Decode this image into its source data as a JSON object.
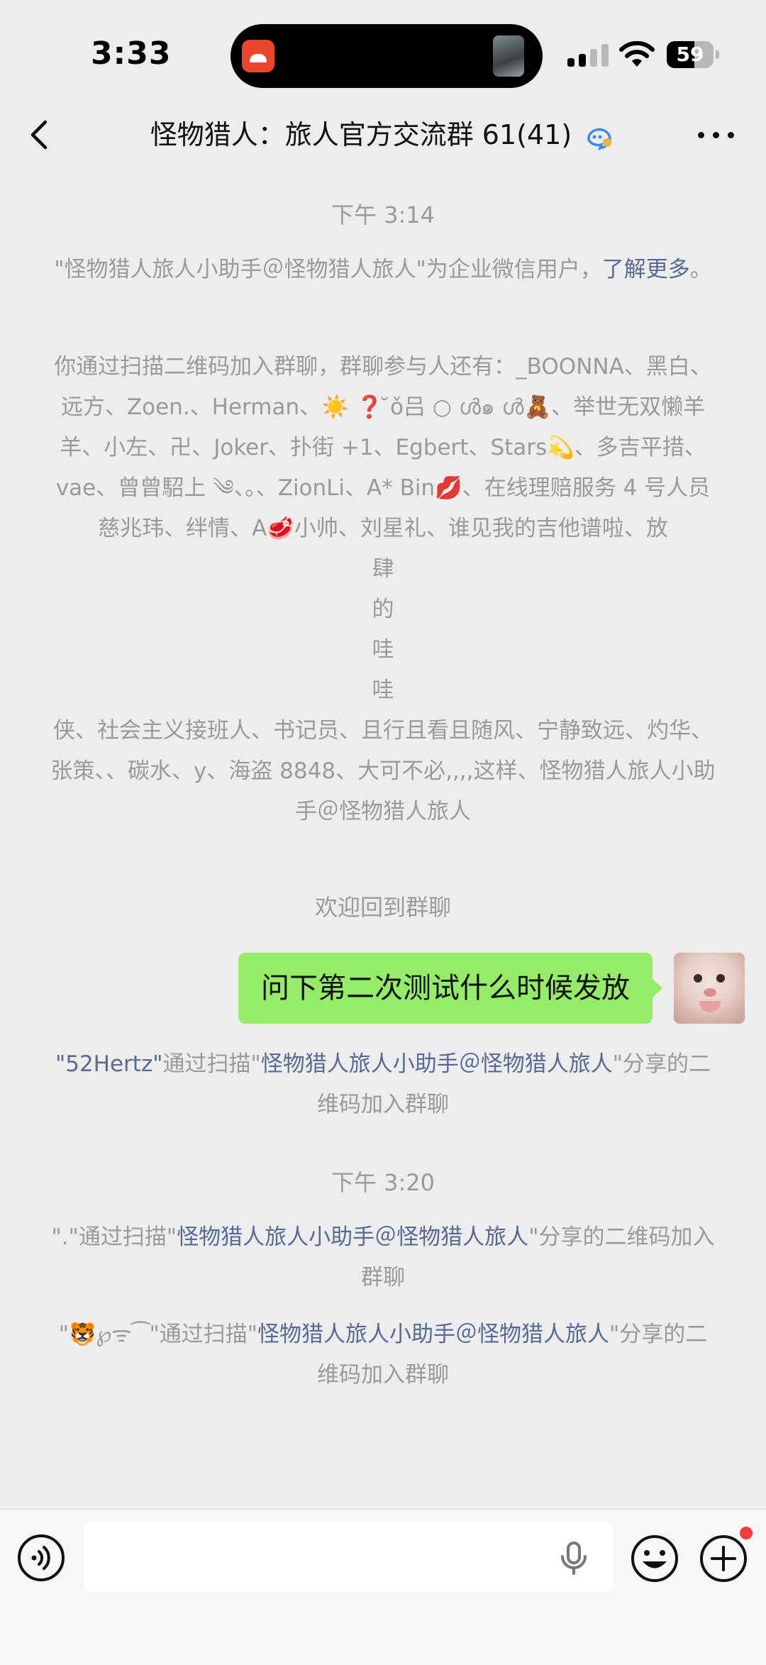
{
  "status_bar": {
    "time": "3:33",
    "battery": "59",
    "battery_level": 0.59
  },
  "nav": {
    "title": "怪物猎人：旅人官方交流群 61(41)"
  },
  "chat": {
    "timestamp1": "下午 3:14",
    "system1": {
      "text": "\"怪物猎人旅人小助手＠怪物猎人旅人\"为企业微信用户，",
      "link": "了解更多",
      "end": "。"
    },
    "system2": {
      "part1": "你通过扫描二维码加入群聊，群聊参与人还有：_BOONNA、黑白、远方、Zoen.、Herman、☀️ ❓ ̆ǒ吕 ○ ൾ๑ ൾ🧸、举世无双懒羊羊、小左、卍、Joker、扑街 +1、Egbert、Stars💫、多吉平措、vae、曾曾駋上 ༄、。、ZionLi、A* Bin💋、在线理赔服务 4 号人员 慈兆玮、绊情、A🥩小帅、刘星礼、谁见我的吉他谱啦、放",
      "vertical": [
        "肆",
        "的",
        "哇",
        "哇"
      ],
      "part2": "侠、社会主义接班人、书记员、且行且看且随风、宁静致远、灼华、张策、、碳水、y、海盗 8848、大可不必,,,,这样、怪物猎人旅人小助手＠怪物猎人旅人"
    },
    "welcome_back": "欢迎回到群聊",
    "my_message": "问下第二次测试什么时候发放",
    "join1": {
      "name": "\"52Hertz\"",
      "mid": "通过扫描\"",
      "link": "怪物猎人旅人小助手＠怪物猎人旅人",
      "end": "\"分享的二维码加入群聊"
    },
    "timestamp2": "下午 3:20",
    "join2": {
      "name": "\".\"",
      "mid": "通过扫描\"",
      "link": "怪物猎人旅人小助手＠怪物猎人旅人",
      "end": "\"分享的二维码加入群聊"
    },
    "join3": {
      "name": "\"🐯℘ᯤ⁀\"",
      "mid": "通过扫描\"",
      "link": "怪物猎人旅人小助手＠怪物猎人旅人",
      "end": "\"分享的二维码加入群聊"
    }
  },
  "input": {
    "value": ""
  },
  "colors": {
    "background": "#ededed",
    "bubble": "#95ec69",
    "link": "#576b95",
    "system_text": "#9a9a9a",
    "badge": "#f23c3c"
  },
  "icons": {
    "back": "chevron-left-icon",
    "group": "group-chat-icon",
    "more": "ellipsis-icon",
    "voice": "voice-icon",
    "mic": "microphone-icon",
    "emoji": "emoji-icon",
    "plus": "plus-icon"
  }
}
